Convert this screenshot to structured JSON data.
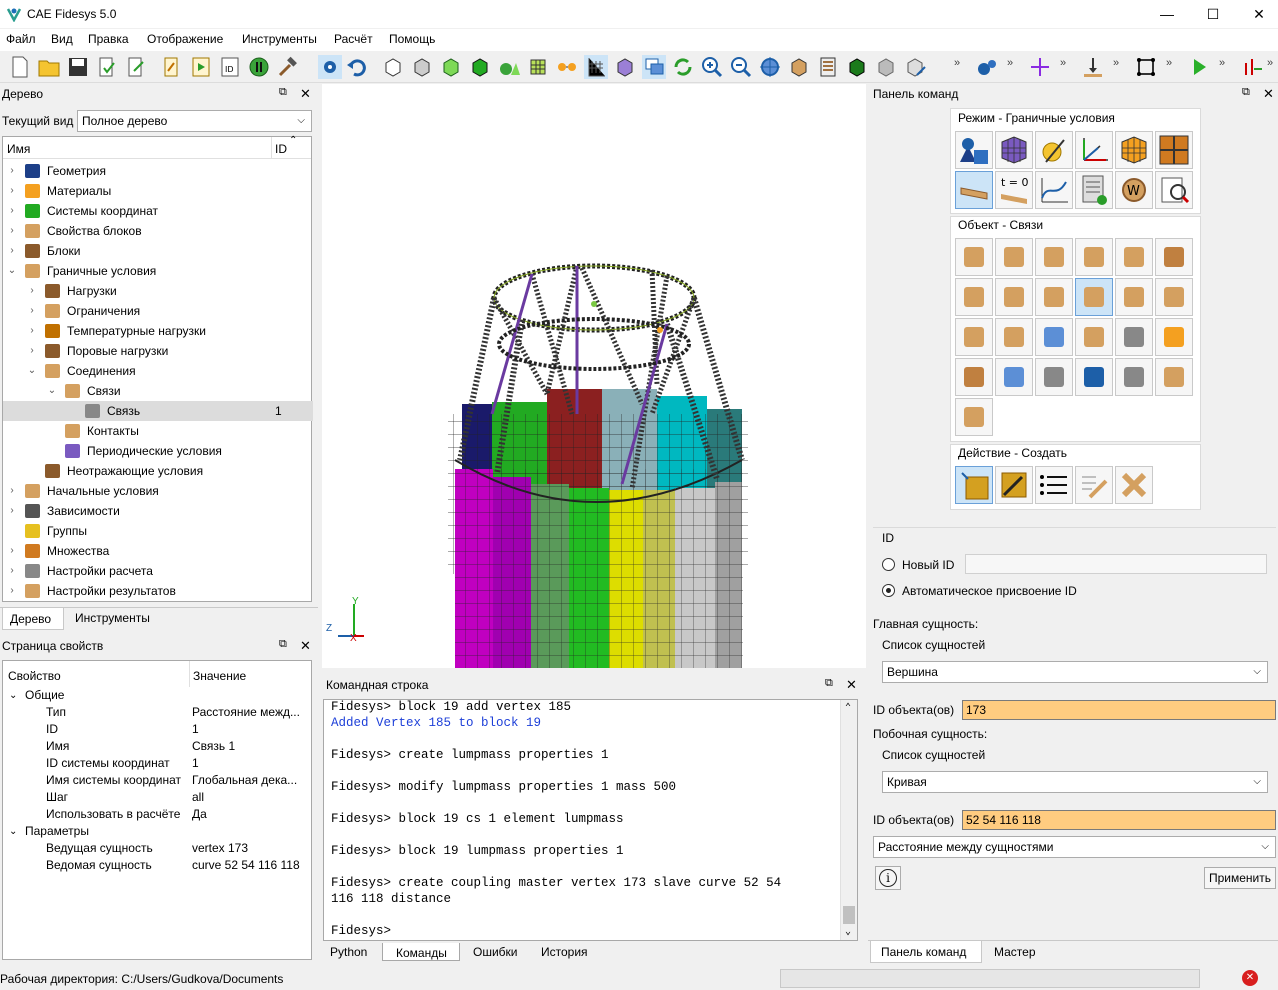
{
  "window": {
    "title": "CAE Fidesys 5.0",
    "minimize": "—",
    "maximize": "☐",
    "close": "✕"
  },
  "menu": [
    "Файл",
    "Вид",
    "Правка",
    "Отображение",
    "Инструменты",
    "Расчёт",
    "Помощь"
  ],
  "toolbar": {
    "overflow": "»"
  },
  "tree_panel": {
    "title": "Дерево",
    "current_view_label": "Текущий вид",
    "current_view_value": "Полное дерево",
    "col_name": "Имя",
    "col_id": "ID",
    "items": [
      {
        "label": "Геометрия",
        "level": 0,
        "arrow": "›",
        "id": ""
      },
      {
        "label": "Материалы",
        "level": 0,
        "arrow": "›",
        "id": ""
      },
      {
        "label": "Системы координат",
        "level": 0,
        "arrow": "›",
        "id": ""
      },
      {
        "label": "Свойства блоков",
        "level": 0,
        "arrow": "›",
        "id": ""
      },
      {
        "label": "Блоки",
        "level": 0,
        "arrow": "›",
        "id": ""
      },
      {
        "label": "Граничные условия",
        "level": 0,
        "arrow": "⌄",
        "id": ""
      },
      {
        "label": "Нагрузки",
        "level": 1,
        "arrow": "›",
        "id": ""
      },
      {
        "label": "Ограничения",
        "level": 1,
        "arrow": "›",
        "id": ""
      },
      {
        "label": "Температурные нагрузки",
        "level": 1,
        "arrow": "›",
        "id": ""
      },
      {
        "label": "Поровые нагрузки",
        "level": 1,
        "arrow": "›",
        "id": ""
      },
      {
        "label": "Соединения",
        "level": 1,
        "arrow": "⌄",
        "id": ""
      },
      {
        "label": "Связи",
        "level": 2,
        "arrow": "⌄",
        "id": ""
      },
      {
        "label": "Связь",
        "level": 3,
        "arrow": "",
        "id": "1"
      },
      {
        "label": "Контакты",
        "level": 2,
        "arrow": "",
        "id": ""
      },
      {
        "label": "Периодические условия",
        "level": 2,
        "arrow": "",
        "id": ""
      },
      {
        "label": "Неотражающие условия",
        "level": 1,
        "arrow": "",
        "id": ""
      },
      {
        "label": "Начальные условия",
        "level": 0,
        "arrow": "›",
        "id": ""
      },
      {
        "label": "Зависимости",
        "level": 0,
        "arrow": "›",
        "id": ""
      },
      {
        "label": "Группы",
        "level": 0,
        "arrow": "",
        "id": ""
      },
      {
        "label": "Множества",
        "level": 0,
        "arrow": "›",
        "id": ""
      },
      {
        "label": "Настройки расчета",
        "level": 0,
        "arrow": "›",
        "id": ""
      },
      {
        "label": "Настройки результатов",
        "level": 0,
        "arrow": "›",
        "id": ""
      }
    ],
    "tabs": [
      "Дерево",
      "Инструменты"
    ]
  },
  "props_panel": {
    "title": "Страница свойств",
    "col_prop": "Свойство",
    "col_value": "Значение",
    "rows": [
      {
        "k": "Общие",
        "v": "",
        "group": true
      },
      {
        "k": "Тип",
        "v": "Расстояние межд...",
        "group": false
      },
      {
        "k": "ID",
        "v": "1",
        "group": false
      },
      {
        "k": "Имя",
        "v": "Связь 1",
        "group": false
      },
      {
        "k": "ID системы координат",
        "v": "1",
        "group": false
      },
      {
        "k": "Имя системы координат",
        "v": "Глобальная дека...",
        "group": false
      },
      {
        "k": "Шаг",
        "v": "all",
        "group": false
      },
      {
        "k": "Использовать в расчёте",
        "v": "Да",
        "group": false
      },
      {
        "k": "Параметры",
        "v": "",
        "group": true
      },
      {
        "k": "Ведущая сущность",
        "v": "vertex 173",
        "group": false
      },
      {
        "k": "Ведомая сущность",
        "v": "curve 52 54 116 118",
        "group": false
      }
    ]
  },
  "viewport": {
    "axis_y": "Y",
    "axis_z": "Z",
    "axis_x": "X"
  },
  "command_line": {
    "title": "Командная строка",
    "lines": [
      {
        "text": "Fidesys> block 19 add vertex 185",
        "kind": "cmd"
      },
      {
        "text": "Added Vertex 185 to block 19",
        "kind": "out"
      },
      {
        "text": "",
        "kind": "cmd"
      },
      {
        "text": "Fidesys> create lumpmass properties 1",
        "kind": "cmd"
      },
      {
        "text": "",
        "kind": "cmd"
      },
      {
        "text": "Fidesys> modify lumpmass properties 1 mass 500",
        "kind": "cmd"
      },
      {
        "text": "",
        "kind": "cmd"
      },
      {
        "text": "Fidesys> block 19 cs 1 element lumpmass",
        "kind": "cmd"
      },
      {
        "text": "",
        "kind": "cmd"
      },
      {
        "text": "Fidesys> block 19 lumpmass properties 1",
        "kind": "cmd"
      },
      {
        "text": "",
        "kind": "cmd"
      },
      {
        "text": "Fidesys> create coupling master vertex 173 slave curve 52 54",
        "kind": "cmd"
      },
      {
        "text": "116 118 distance",
        "kind": "cmd"
      },
      {
        "text": "",
        "kind": "cmd"
      },
      {
        "text": "Fidesys>",
        "kind": "cmd"
      }
    ],
    "tabs": [
      "Python",
      "Команды",
      "Ошибки",
      "История"
    ]
  },
  "command_panel": {
    "title": "Панель команд",
    "mode_label": "Режим - Граничные условия",
    "object_label": "Объект - Связи",
    "action_label": "Действие - Создать",
    "id_group": "ID",
    "new_id": "Новый ID",
    "auto_id": "Автоматическое присвоение ID",
    "master_label": "Главная сущность:",
    "entity_list": "Список сущностей",
    "master_entity": "Вершина",
    "object_id_label": "ID объекта(ов)",
    "master_id": "173",
    "slave_label": "Побочная сущность:",
    "slave_entity": "Кривая",
    "slave_id": "52 54 116 118",
    "coupling_type": "Расстояние между сущностями",
    "apply": "Применить",
    "info": "i",
    "tabs": [
      "Панель команд",
      "Мастер"
    ]
  },
  "status_bar": {
    "working_dir": "Рабочая директория: C:/Users/Gudkova/Documents"
  }
}
